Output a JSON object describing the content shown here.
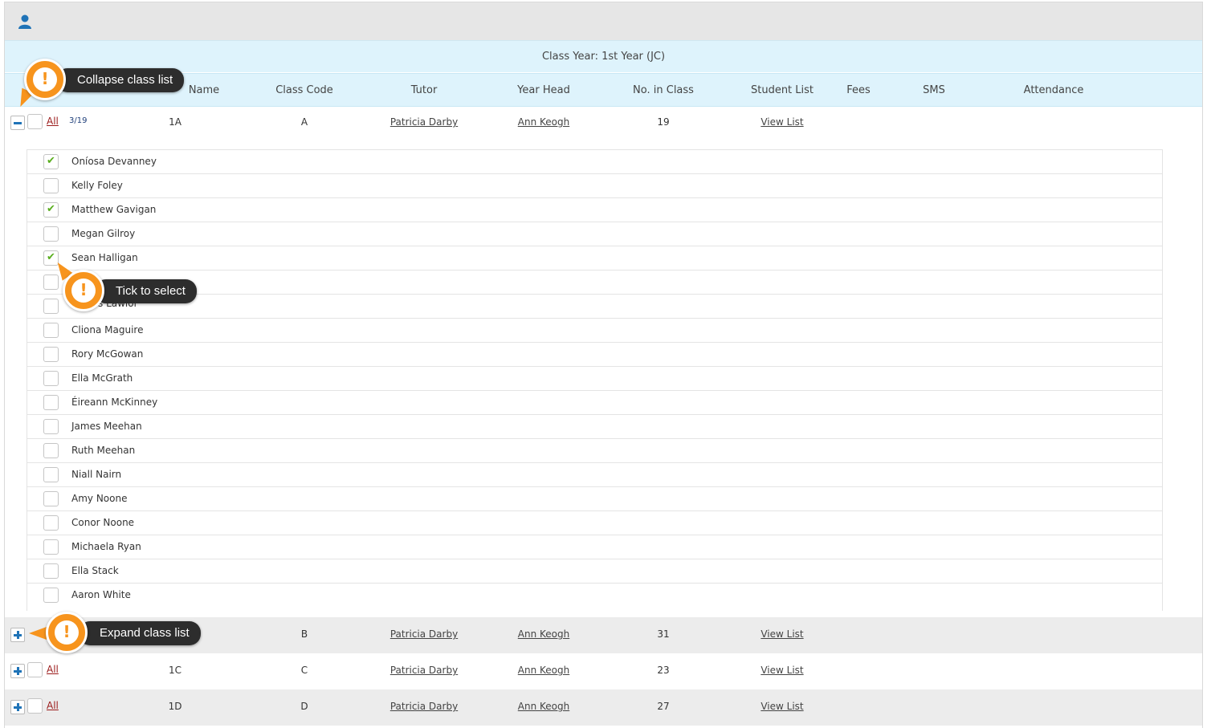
{
  "class_year": "Class Year: 1st Year (JC)",
  "columns": {
    "name": "Name",
    "class_code": "Class Code",
    "tutor": "Tutor",
    "year_head": "Year Head",
    "no_in_class": "No. in Class",
    "student_list": "Student List",
    "fees": "Fees",
    "sms": "SMS",
    "attendance": "Attendance"
  },
  "all_label": "All",
  "classes": [
    {
      "name": "1A",
      "code": "A",
      "tutor": "Patricia Darby",
      "year_head": "Ann Keogh",
      "count": "19",
      "list": "View List",
      "selected": "3/19",
      "expanded": true
    },
    {
      "name": "",
      "code": "B",
      "tutor": "Patricia Darby",
      "year_head": "Ann Keogh",
      "count": "31",
      "list": "View List"
    },
    {
      "name": "1C",
      "code": "C",
      "tutor": "Patricia Darby",
      "year_head": "Ann Keogh",
      "count": "23",
      "list": "View List"
    },
    {
      "name": "1D",
      "code": "D",
      "tutor": "Patricia Darby",
      "year_head": "Ann Keogh",
      "count": "27",
      "list": "View List"
    }
  ],
  "students": [
    {
      "name": "Oníosa Devanney",
      "checked": true
    },
    {
      "name": "Kelly Foley",
      "checked": false
    },
    {
      "name": "Matthew Gavigan",
      "checked": true
    },
    {
      "name": "Megan Gilroy",
      "checked": false
    },
    {
      "name": "Sean Halligan",
      "checked": true
    },
    {
      "name": "",
      "checked": false
    },
    {
      "name": "s Lawlor",
      "checked": false
    },
    {
      "name": "Cliona Maguire",
      "checked": false
    },
    {
      "name": "Rory McGowan",
      "checked": false
    },
    {
      "name": "Ella McGrath",
      "checked": false
    },
    {
      "name": "Éireann McKinney",
      "checked": false
    },
    {
      "name": "James Meehan",
      "checked": false
    },
    {
      "name": "Ruth Meehan",
      "checked": false
    },
    {
      "name": "Niall Nairn",
      "checked": false
    },
    {
      "name": "Amy Noone",
      "checked": false
    },
    {
      "name": "Conor Noone",
      "checked": false
    },
    {
      "name": "Michaela Ryan",
      "checked": false
    },
    {
      "name": "Ella Stack",
      "checked": false
    },
    {
      "name": "Aaron White",
      "checked": false
    }
  ],
  "callouts": {
    "collapse": "Collapse class list",
    "tick": "Tick to select",
    "expand": "Expand class list"
  },
  "icons": {
    "user": "user-icon",
    "collapse": "minus-icon",
    "expand": "plus-icon",
    "check": "checkmark-icon",
    "alert": "exclamation-icon"
  },
  "colors": {
    "header_bg": "#def3fc",
    "callout_badge": "#f7941d",
    "callout_bg": "#2d2d2d",
    "all_link": "#9b1b1b",
    "toggle_icon": "#1f73b7",
    "check": "#5aae1f"
  }
}
